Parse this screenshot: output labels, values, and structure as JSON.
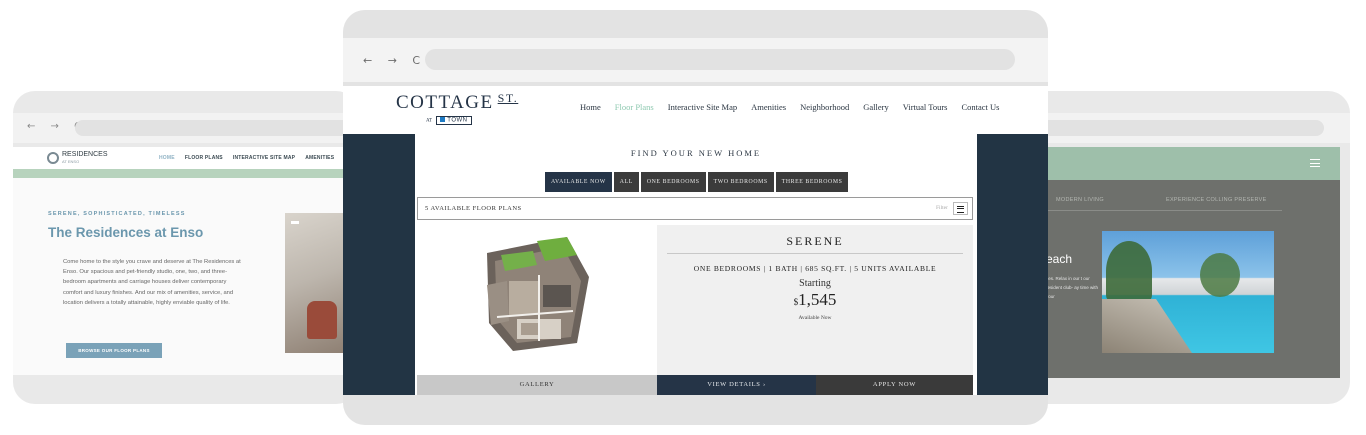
{
  "left_site": {
    "logo": {
      "name": "RESIDENCES",
      "sub": "AT ENSO"
    },
    "nav": [
      "HOME",
      "FLOOR PLANS",
      "INTERACTIVE SITE MAP",
      "AMENITIES"
    ],
    "eyebrow": "SERENE, SOPHISTICATED, TIMELESS",
    "title": "The Residences at Enso",
    "body": "Come home to the style you crave and deserve at The Residences at Enso. Our spacious and pet-friendly studio, one, two, and three-bedroom apartments and carriage houses deliver contemporary comfort and luxury finishes. And our mix of amenities, service, and location delivers a totally attainable, highly enviable quality of life.",
    "cta": "BROWSE OUR FLOOR PLANS"
  },
  "right_site": {
    "tabs": [
      "MODERN LIVING",
      "EXPERIENCE COLLING PRESERVE"
    ],
    "title": "each",
    "body": "ties. Relax in our t our resident club- ay time with your"
  },
  "center_site": {
    "logo": {
      "word": "COTTAGE",
      "st": "ST.",
      "at": "AT",
      "town": "TOWN"
    },
    "nav": [
      "Home",
      "Floor Plans",
      "Interactive Site Map",
      "Amenities",
      "Neighborhood",
      "Gallery",
      "Virtual Tours",
      "Contact Us"
    ],
    "find_title": "FIND YOUR NEW HOME",
    "filters": [
      "AVAILABLE NOW",
      "ALL",
      "ONE BEDROOMS",
      "TWO BEDROOMS",
      "THREE BEDROOMS"
    ],
    "count_text": "5 AVAILABLE FLOOR PLANS",
    "filter_label": "Filter",
    "plan": {
      "name": "SERENE",
      "spec": "ONE BEDROOMS | 1 BATH | 685 SQ.FT. | 5 UNITS AVAILABLE",
      "starting": "Starting",
      "currency": "$",
      "price": "1,545",
      "availability": "Available Now"
    },
    "buttons": {
      "gallery": "GALLERY",
      "details": "VIEW DETAILS ›",
      "apply": "APPLY NOW"
    }
  },
  "browser": {
    "nav_glyphs": "← → C"
  },
  "colors": {
    "navy": "#253447",
    "accent_green": "#8ec9b0",
    "enso_blue": "#6b97ad",
    "pool_header": "#9ebfaa"
  }
}
